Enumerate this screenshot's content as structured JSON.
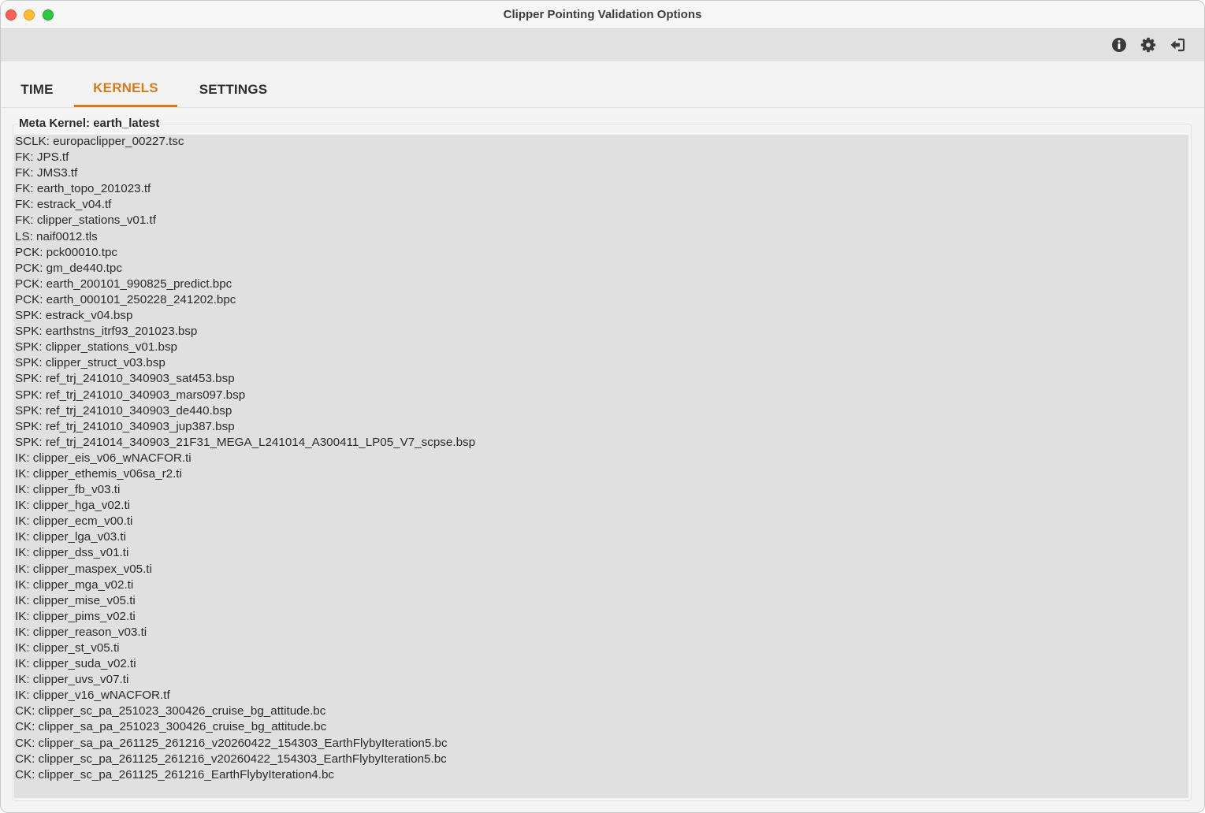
{
  "window": {
    "title": "Clipper Pointing Validation Options"
  },
  "toolbar": {
    "icons": [
      "info-icon",
      "gear-icon",
      "sign-out-icon"
    ]
  },
  "tabs": [
    {
      "label": "TIME",
      "active": false
    },
    {
      "label": "KERNELS",
      "active": true
    },
    {
      "label": "SETTINGS",
      "active": false
    }
  ],
  "colors": {
    "accent": "#d9791c",
    "list_background": "#e0e0e0",
    "window_background": "#f4f4f4",
    "toolbar_background": "#e1e1e1"
  },
  "kernels": {
    "group_title": "Meta Kernel: earth_latest",
    "items": [
      "SCLK: europaclipper_00227.tsc",
      "FK: JPS.tf",
      "FK: JMS3.tf",
      "FK: earth_topo_201023.tf",
      "FK: estrack_v04.tf",
      "FK: clipper_stations_v01.tf",
      "LS: naif0012.tls",
      "PCK: pck00010.tpc",
      "PCK: gm_de440.tpc",
      "PCK: earth_200101_990825_predict.bpc",
      "PCK: earth_000101_250228_241202.bpc",
      "SPK: estrack_v04.bsp",
      "SPK: earthstns_itrf93_201023.bsp",
      "SPK: clipper_stations_v01.bsp",
      "SPK: clipper_struct_v03.bsp",
      "SPK: ref_trj_241010_340903_sat453.bsp",
      "SPK: ref_trj_241010_340903_mars097.bsp",
      "SPK: ref_trj_241010_340903_de440.bsp",
      "SPK: ref_trj_241010_340903_jup387.bsp",
      "SPK: ref_trj_241014_340903_21F31_MEGA_L241014_A300411_LP05_V7_scpse.bsp",
      "IK: clipper_eis_v06_wNACFOR.ti",
      "IK: clipper_ethemis_v06sa_r2.ti",
      "IK: clipper_fb_v03.ti",
      "IK: clipper_hga_v02.ti",
      "IK: clipper_ecm_v00.ti",
      "IK: clipper_lga_v03.ti",
      "IK: clipper_dss_v01.ti",
      "IK: clipper_maspex_v05.ti",
      "IK: clipper_mga_v02.ti",
      "IK: clipper_mise_v05.ti",
      "IK: clipper_pims_v02.ti",
      "IK: clipper_reason_v03.ti",
      "IK: clipper_st_v05.ti",
      "IK: clipper_suda_v02.ti",
      "IK: clipper_uvs_v07.ti",
      "IK: clipper_v16_wNACFOR.tf",
      "CK: clipper_sc_pa_251023_300426_cruise_bg_attitude.bc",
      "CK: clipper_sa_pa_251023_300426_cruise_bg_attitude.bc",
      "CK: clipper_sa_pa_261125_261216_v20260422_154303_EarthFlybyIteration5.bc",
      "CK: clipper_sc_pa_261125_261216_v20260422_154303_EarthFlybyIteration5.bc",
      "CK: clipper_sc_pa_261125_261216_EarthFlybyIteration4.bc"
    ]
  }
}
